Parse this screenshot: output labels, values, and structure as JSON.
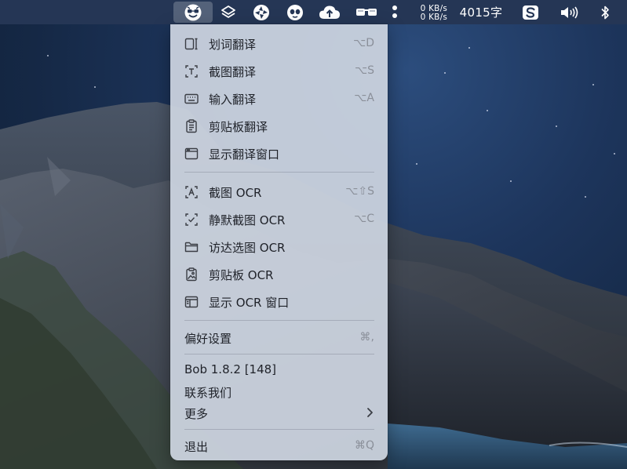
{
  "menubar": {
    "app_icons": [
      "bob-app-icon",
      "layers-icon",
      "shutter-icon",
      "alien-icon",
      "cloud-upload-icon",
      "glasses-icon",
      "more-dots-icon"
    ],
    "net_up": "0 KB/s",
    "net_down": "0 KB/s",
    "word_count": "4015字",
    "sogou_icon": "sogou-s-icon",
    "volume_icon": "volume-icon",
    "bluetooth_icon": "bluetooth-icon"
  },
  "menu": {
    "translate": [
      {
        "label": "划词翻译",
        "shortcut": "⌥D",
        "icon": "select-text-icon"
      },
      {
        "label": "截图翻译",
        "shortcut": "⌥S",
        "icon": "screenshot-text-icon"
      },
      {
        "label": "输入翻译",
        "shortcut": "⌥A",
        "icon": "keyboard-icon"
      },
      {
        "label": "剪贴板翻译",
        "shortcut": "",
        "icon": "clipboard-icon"
      },
      {
        "label": "显示翻译窗口",
        "shortcut": "",
        "icon": "window-icon"
      }
    ],
    "ocr": [
      {
        "label": "截图 OCR",
        "shortcut": "⌥⇧S",
        "icon": "screenshot-ocr-icon"
      },
      {
        "label": "静默截图 OCR",
        "shortcut": "⌥C",
        "icon": "silent-screenshot-icon"
      },
      {
        "label": "访达选图 OCR",
        "shortcut": "",
        "icon": "folder-icon"
      },
      {
        "label": "剪贴板 OCR",
        "shortcut": "",
        "icon": "clipboard-image-icon"
      },
      {
        "label": "显示 OCR 窗口",
        "shortcut": "",
        "icon": "ocr-window-icon"
      }
    ],
    "preferences": {
      "label": "偏好设置",
      "shortcut": "⌘,"
    },
    "version": "Bob 1.8.2 [148]",
    "contact": "联系我们",
    "more": "更多",
    "quit": {
      "label": "退出",
      "shortcut": "⌘Q"
    }
  }
}
